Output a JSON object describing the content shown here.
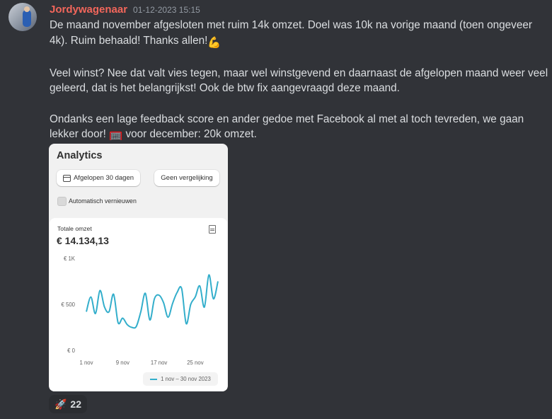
{
  "message": {
    "username": "Jordywagenaar",
    "timestamp": "01-12-2023 15:15",
    "paragraphs": {
      "p1": "De maand november afgesloten met ruim 14k omzet. Doel was 10k na vorige maand (toen ongeveer 4k). Ruim behaald! Thanks allen!",
      "p1_emoji": "💪",
      "p2": "Veel winst? Nee dat valt vies tegen, maar wel winstgevend en daarnaast de afgelopen maand weer veel geleerd, dat is het belangrijkst! Ook de btw fix aangevraagd deze maand.",
      "p3a": "Ondanks een lage feedback score en ander gedoe met Facebook al met al toch tevreden, we gaan lekker door!",
      "p3_emoji": "🥅",
      "p3b": "voor december: 20k omzet."
    }
  },
  "analytics": {
    "title": "Analytics",
    "date_range_button": "Afgelopen 30 dagen",
    "compare_button": "Geen vergelijking",
    "auto_refresh_label": "Automatisch vernieuwen",
    "metric_label": "Totale omzet",
    "metric_value": "€ 14.134,13",
    "legend_label": "1 nov – 30 nov 2023"
  },
  "chart_data": {
    "type": "line",
    "y_ticks": [
      "€ 0",
      "€ 500",
      "€ 1K"
    ],
    "x_ticks": [
      "1 nov",
      "9 nov",
      "17 nov",
      "25 nov"
    ],
    "ylim": [
      0,
      1000
    ],
    "series": [
      {
        "color": "#33aecb",
        "values": [
          420,
          580,
          400,
          650,
          470,
          420,
          610,
          300,
          350,
          280,
          250,
          260,
          420,
          620,
          330,
          560,
          600,
          520,
          360,
          510,
          630,
          670,
          290,
          500,
          580,
          700,
          470,
          820,
          560,
          750
        ]
      }
    ]
  },
  "reaction": {
    "emoji": "🚀",
    "count": "22"
  },
  "colors": {
    "background": "#313338",
    "username": "#f2665b",
    "line": "#33aecb"
  }
}
